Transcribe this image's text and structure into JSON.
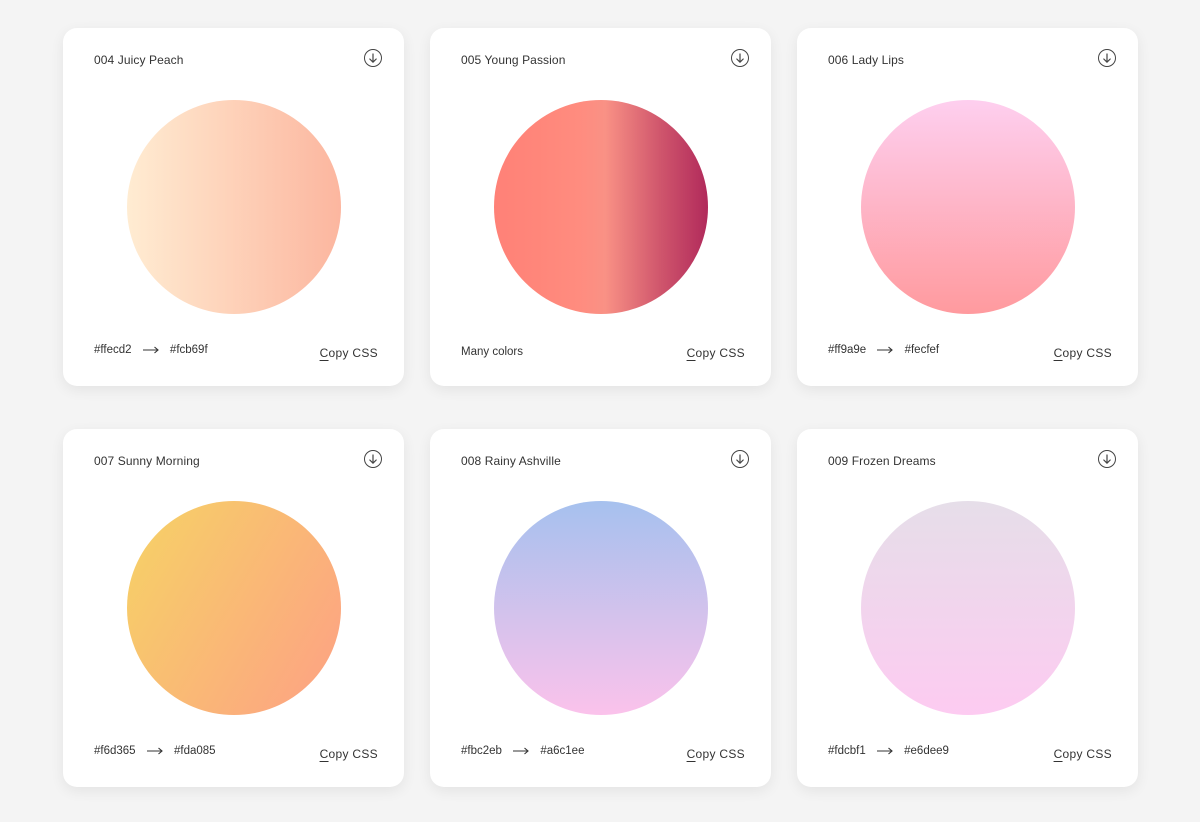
{
  "cards": [
    {
      "title": "004 Juicy Peach",
      "from": "#ffecd2",
      "to": "#fcb69f",
      "arrow": "→",
      "copy_first": "C",
      "copy_rest": "opy CSS",
      "gradient": "linear-gradient(to right, #ffecd2, #fcb69f)"
    },
    {
      "title": "005 Young Passion",
      "text": "Many colors",
      "copy_first": "C",
      "copy_rest": "opy CSS",
      "gradient": "linear-gradient(to right, #ff8177 0%, #ff867a 20%, #ff8c7f 40%, #f99185 52%, #cf556c 78%, #b12a5b 100%)"
    },
    {
      "title": "006 Lady Lips",
      "from": "#ff9a9e",
      "to": "#fecfef",
      "arrow": "→",
      "copy_first": "C",
      "copy_rest": "opy CSS",
      "gradient": "linear-gradient(to top, #ff9a9e, #fecfef)"
    },
    {
      "title": "007 Sunny Morning",
      "from": "#f6d365",
      "to": "#fda085",
      "arrow": "→",
      "copy_first": "C",
      "copy_rest": "opy CSS",
      "gradient": "linear-gradient(120deg, #f6d365, #fda085)"
    },
    {
      "title": "008 Rainy Ashville",
      "from": "#fbc2eb",
      "to": "#a6c1ee",
      "arrow": "→",
      "copy_first": "C",
      "copy_rest": "opy CSS",
      "gradient": "linear-gradient(to top, #fbc2eb, #a6c1ee)"
    },
    {
      "title": "009 Frozen Dreams",
      "from": "#fdcbf1",
      "to": "#e6dee9",
      "arrow": "→",
      "copy_first": "C",
      "copy_rest": "opy CSS",
      "gradient": "linear-gradient(to top, #fdcbf1, #e6dee9)"
    }
  ],
  "icons": {
    "download": "download-circle-icon",
    "arrow": "arrow-right-icon"
  },
  "colors": {
    "background": "#f4f4f4",
    "card": "#ffffff",
    "text": "#333333"
  }
}
